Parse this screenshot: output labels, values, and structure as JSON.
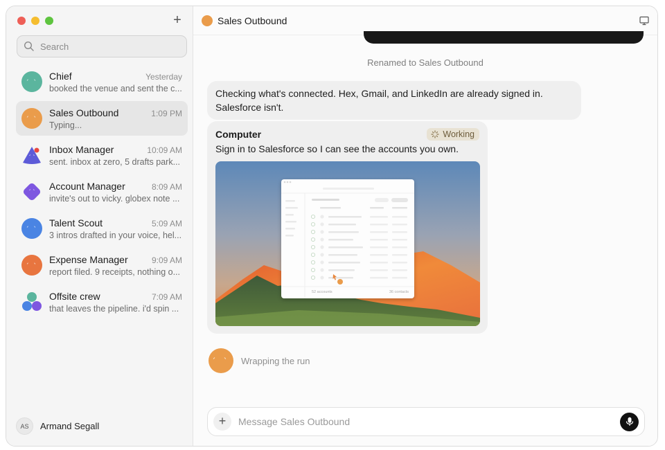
{
  "sidebar": {
    "search_placeholder": "Search",
    "conversations": [
      {
        "name": "Chief",
        "time": "Yesterday",
        "preview": "booked the venue and sent the c...",
        "color": "#5bb59e",
        "active": false
      },
      {
        "name": "Sales Outbound",
        "time": "1:09 PM",
        "preview": "Typing...",
        "color": "#ea9c4b",
        "active": true
      },
      {
        "name": "Inbox Manager",
        "time": "10:09 AM",
        "preview": "sent. inbox at zero, 5 drafts park...",
        "color": "#5d5bd8",
        "active": false
      },
      {
        "name": "Account Manager",
        "time": "8:09 AM",
        "preview": "invite's out to vicky. globex note ...",
        "color": "#7e57e0",
        "active": false
      },
      {
        "name": "Talent Scout",
        "time": "5:09 AM",
        "preview": "3 intros drafted in your voice, hel...",
        "color": "#4a84e3",
        "active": false
      },
      {
        "name": "Expense Manager",
        "time": "9:09 AM",
        "preview": "report filed. 9 receipts, nothing o...",
        "color": "#e8753f",
        "active": false
      },
      {
        "name": "Offsite crew",
        "time": "7:09 AM",
        "preview": "that leaves the pipeline. i'd spin ...",
        "color": "#6a63e0",
        "active": false
      }
    ],
    "user": {
      "initials": "AS",
      "name": "Armand Segall"
    }
  },
  "header": {
    "title": "Sales Outbound",
    "icon": "monitor-icon"
  },
  "chat": {
    "rename_note": "Renamed to Sales Outbound",
    "message_1": "Checking what's connected. Hex, Gmail, and LinkedIn are already signed in. Salesforce isn't.",
    "computer_card": {
      "title": "Computer",
      "badge": "Working",
      "text": "Sign in to Salesforce so I can see the accounts you own.",
      "mini_footer_left": "52 accounts",
      "mini_footer_right": "36 contacts"
    },
    "status": "Wrapping the run"
  },
  "composer": {
    "placeholder": "Message Sales Outbound"
  },
  "colors": {
    "accent": "#ea9c4b",
    "badge_bg": "#e8e2d3",
    "mic_bg": "#111111"
  }
}
